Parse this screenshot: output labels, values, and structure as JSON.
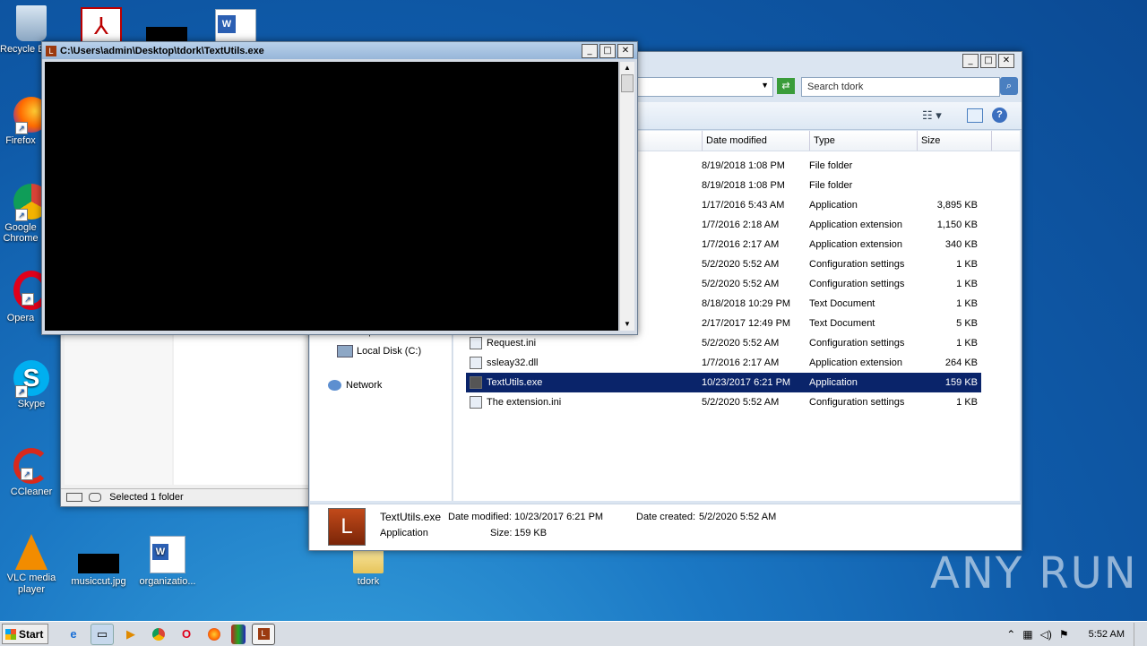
{
  "desktop": {
    "icons": [
      {
        "label": "Recycle Bin"
      },
      {
        "label": "Firefox"
      },
      {
        "label": "Google Chrome"
      },
      {
        "label": "Opera"
      },
      {
        "label": "Skype"
      },
      {
        "label": "CCleaner"
      },
      {
        "label": "VLC media player"
      },
      {
        "label": "musiccut.jpg"
      },
      {
        "label": "organizatio..."
      },
      {
        "label": "tdork"
      }
    ],
    "watermark": "ANY RUN"
  },
  "console": {
    "title": "C:\\Users\\admin\\Desktop\\tdork\\TextUtils.exe",
    "icon_letter": "L"
  },
  "explorer": {
    "search_placeholder": "Search tdork",
    "columns": [
      "Date modified",
      "Type",
      "Size"
    ],
    "rows": [
      {
        "name": "",
        "date": "8/19/2018 1:08 PM",
        "type": "File folder",
        "size": ""
      },
      {
        "name": "",
        "date": "8/19/2018 1:08 PM",
        "type": "File folder",
        "size": ""
      },
      {
        "name": "",
        "date": "1/17/2016 5:43 AM",
        "type": "Application",
        "size": "3,895 KB"
      },
      {
        "name": "",
        "date": "1/7/2016 2:18 AM",
        "type": "Application extension",
        "size": "1,150 KB"
      },
      {
        "name": "",
        "date": "1/7/2016 2:17 AM",
        "type": "Application extension",
        "size": "340 KB"
      },
      {
        "name": "",
        "date": "5/2/2020 5:52 AM",
        "type": "Configuration settings",
        "size": "1 KB"
      },
      {
        "name": "",
        "date": "5/2/2020 5:52 AM",
        "type": "Configuration settings",
        "size": "1 KB"
      },
      {
        "name": "",
        "date": "8/18/2018 10:29 PM",
        "type": "Text Document",
        "size": "1 KB"
      },
      {
        "name": "",
        "date": "2/17/2017 12:49 PM",
        "type": "Text Document",
        "size": "5 KB"
      },
      {
        "name": "Request.ini",
        "date": "5/2/2020 5:52 AM",
        "type": "Configuration settings",
        "size": "1 KB"
      },
      {
        "name": "ssleay32.dll",
        "date": "1/7/2016 2:17 AM",
        "type": "Application extension",
        "size": "264 KB"
      },
      {
        "name": "TextUtils.exe",
        "date": "10/23/2017 6:21 PM",
        "type": "Application",
        "size": "159 KB"
      },
      {
        "name": "The extension.ini",
        "date": "5/2/2020 5:52 AM",
        "type": "Configuration settings",
        "size": "1 KB"
      }
    ],
    "nav": {
      "computer": "Computer",
      "local_disk": "Local Disk (C:)",
      "network": "Network"
    },
    "details": {
      "name": "TextUtils.exe",
      "type": "Application",
      "date_modified_label": "Date modified:",
      "date_modified": "10/23/2017 6:21 PM",
      "date_created_label": "Date created:",
      "date_created": "5/2/2020 5:52 AM",
      "size_label": "Size:",
      "size": "159 KB"
    }
  },
  "back_window": {
    "status": "Selected 1 folder"
  },
  "taskbar": {
    "start": "Start",
    "clock": "5:52 AM"
  }
}
